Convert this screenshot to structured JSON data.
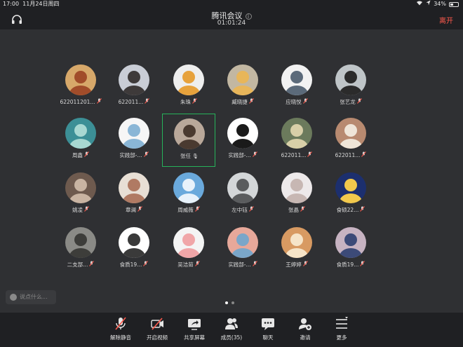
{
  "status": {
    "time": "17:00",
    "date": "11月24日周四",
    "battery": "34%",
    "battery_level": 0.34
  },
  "header": {
    "title": "腾讯会议",
    "timer": "01:01:24",
    "leave": "离开"
  },
  "participants": [
    {
      "name": "622011201...",
      "mic": "muted",
      "avatar": {
        "bg": "#d7a86a",
        "fg": "#a14c2a"
      }
    },
    {
      "name": "622011...",
      "mic": "muted",
      "avatar": {
        "bg": "#c9cdd6",
        "fg": "#3e3a3a"
      }
    },
    {
      "name": "朱珠",
      "mic": "muted",
      "avatar": {
        "bg": "#eeeeee",
        "fg": "#e7a23c"
      }
    },
    {
      "name": "臧晓捷",
      "mic": "muted",
      "avatar": {
        "bg": "#c2b7a2",
        "fg": "#e8b65a"
      }
    },
    {
      "name": "应晓悦",
      "mic": "muted",
      "avatar": {
        "bg": "#f2f2f2",
        "fg": "#5b6a7a"
      }
    },
    {
      "name": "张艺龙",
      "mic": "muted",
      "avatar": {
        "bg": "#bfc5c8",
        "fg": "#2b2b2b"
      }
    },
    {
      "name": "周鑫",
      "mic": "muted",
      "avatar": {
        "bg": "#3c8f96",
        "fg": "#a8d8d2"
      }
    },
    {
      "name": "实践部-...",
      "mic": "muted",
      "avatar": {
        "bg": "#f6f6f6",
        "fg": "#8ab6d6"
      }
    },
    {
      "name": "张任",
      "mic": "on",
      "active": true,
      "avatar": {
        "bg": "#b9a89a",
        "fg": "#4a3a30"
      }
    },
    {
      "name": "实践部-...",
      "mic": "muted",
      "avatar": {
        "bg": "#ffffff",
        "fg": "#1a1a1a"
      }
    },
    {
      "name": "622011...",
      "mic": "muted",
      "avatar": {
        "bg": "#6b7a5c",
        "fg": "#d8cfa8"
      }
    },
    {
      "name": "622011...",
      "mic": "muted",
      "avatar": {
        "bg": "#b88a70",
        "fg": "#efe5d8"
      }
    },
    {
      "name": "姚凌",
      "mic": "muted",
      "avatar": {
        "bg": "#6e5a4e",
        "fg": "#c9b4a2"
      }
    },
    {
      "name": "章澜",
      "mic": "muted",
      "avatar": {
        "bg": "#e8dfd5",
        "fg": "#b07a63"
      }
    },
    {
      "name": "周威薇",
      "mic": "muted",
      "avatar": {
        "bg": "#6aa9dc",
        "fg": "#e8f2fb"
      }
    },
    {
      "name": "左中钰",
      "mic": "muted",
      "avatar": {
        "bg": "#d3d6d8",
        "fg": "#5a5c5e"
      }
    },
    {
      "name": "张晶",
      "mic": "muted",
      "avatar": {
        "bg": "#ede9ea",
        "fg": "#c7b7b3"
      }
    },
    {
      "name": "食硕22...",
      "mic": "muted",
      "avatar": {
        "bg": "#1c2f6e",
        "fg": "#f2c94c"
      }
    },
    {
      "name": "二支部...",
      "mic": "muted",
      "avatar": {
        "bg": "#8a8a86",
        "fg": "#3d3d3a"
      }
    },
    {
      "name": "食质19...",
      "mic": "muted",
      "avatar": {
        "bg": "#ffffff",
        "fg": "#3a3a3a"
      }
    },
    {
      "name": "吴洁茹",
      "mic": "muted",
      "avatar": {
        "bg": "#f4f4f4",
        "fg": "#f0a6a8"
      }
    },
    {
      "name": "实践部-...",
      "mic": "muted",
      "avatar": {
        "bg": "#e7a89a",
        "fg": "#7aa6c9"
      }
    },
    {
      "name": "王婷婷",
      "mic": "muted",
      "avatar": {
        "bg": "#d89a62",
        "fg": "#f6e4c8"
      }
    },
    {
      "name": "食质19...",
      "mic": "muted",
      "avatar": {
        "bg": "#c7b3c2",
        "fg": "#3c4a78"
      }
    }
  ],
  "chat": {
    "placeholder": "说点什么..."
  },
  "pager": {
    "pages": 2,
    "current": 1
  },
  "toolbar": [
    {
      "id": "unmute",
      "label": "解除静音",
      "icon": "mic-muted-icon"
    },
    {
      "id": "video",
      "label": "开启视频",
      "icon": "video-off-icon"
    },
    {
      "id": "share",
      "label": "共享屏幕",
      "icon": "share-screen-icon"
    },
    {
      "id": "members",
      "label": "成员(35)",
      "icon": "members-icon"
    },
    {
      "id": "chat",
      "label": "聊天",
      "icon": "chat-icon"
    },
    {
      "id": "invite",
      "label": "邀请",
      "icon": "invite-icon"
    },
    {
      "id": "more",
      "label": "更多",
      "icon": "more-icon"
    }
  ],
  "colors": {
    "accent_red": "#ff5a4d",
    "active_border": "#26b35a",
    "bg": "#2f3033",
    "bar": "#1f2023"
  }
}
